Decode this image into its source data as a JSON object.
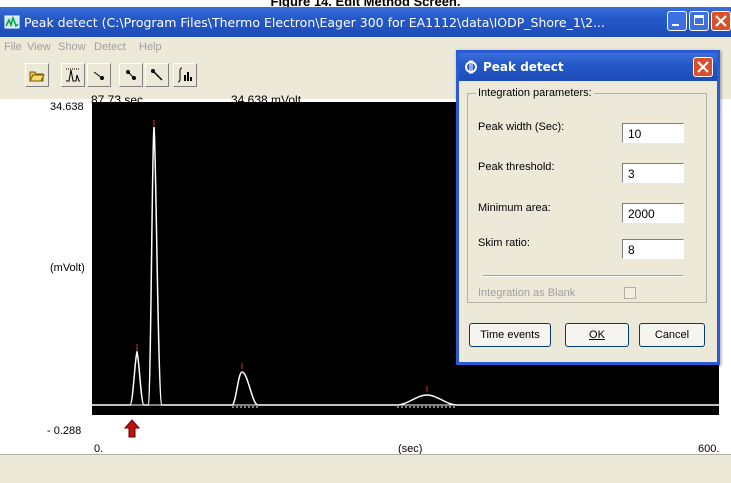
{
  "caption": "Figure 14. Edit Method Screen.",
  "window": {
    "title": "Peak detect (C:\\Program Files\\Thermo Electron\\Eager 300 for EA1112\\data\\IODP_Shore_1\\2..."
  },
  "menu": [
    "File",
    "View",
    "Show",
    "Detect",
    "Help"
  ],
  "toolbar": {
    "tools": [
      "open-icon",
      "peak-zoom-icon",
      "single-point-icon",
      "two-points-icon",
      "pointer-tool-icon",
      "integrate-icon"
    ]
  },
  "plot": {
    "y_max_label": "34.638",
    "y_min_label": "- 0.288",
    "y_unit_label": "(mVolt)",
    "cursor_time": "87.73 sec",
    "cursor_value": "34.638 mVolt",
    "x_min_label": "0.",
    "x_unit_label": "(sec)",
    "x_max_label": "600."
  },
  "dialog": {
    "title": "Peak detect",
    "group_label": "Integration parameters:",
    "fields": [
      {
        "label": "Peak width (Sec):",
        "value": "10"
      },
      {
        "label": "Peak threshold:",
        "value": "3"
      },
      {
        "label": "Minimum area:",
        "value": "2000"
      },
      {
        "label": "Skim ratio:",
        "value": "8"
      }
    ],
    "blank_label": "Integration as Blank",
    "blank_checked": false,
    "buttons": {
      "time_events": "Time events",
      "ok": "OK",
      "cancel": "Cancel"
    }
  }
}
